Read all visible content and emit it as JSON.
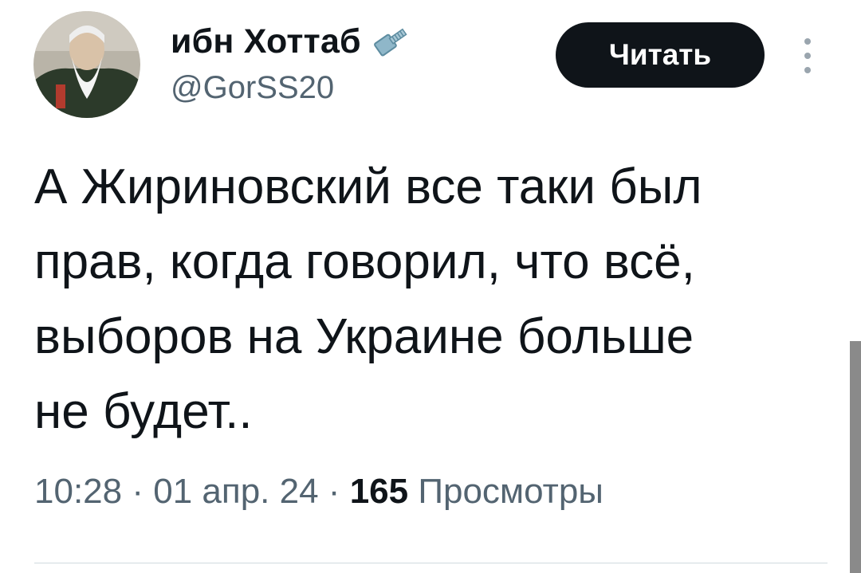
{
  "user": {
    "display_name": "ибн Хоттаб",
    "badge_icon": "bolt-icon",
    "handle": "@GorSS20"
  },
  "follow_button": {
    "label": "Читать"
  },
  "more_menu": {
    "icon": "more-vertical-icon"
  },
  "tweet": {
    "text_lines": [
      "А Жириновский все таки был",
      "прав, когда говорил, что всё,",
      "выборов на Украине больше",
      "не будет.."
    ]
  },
  "meta": {
    "time": "10:28",
    "separator": "·",
    "date": "01 апр. 24",
    "views_count": "165",
    "views_label": "Просмотры"
  },
  "colors": {
    "text_primary": "#0f1419",
    "text_secondary": "#536471",
    "button_bg": "#0f1419",
    "button_text": "#ffffff",
    "divider": "#cfd9de"
  }
}
